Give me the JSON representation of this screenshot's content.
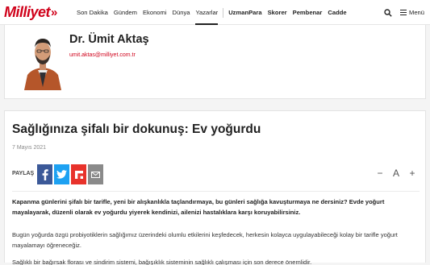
{
  "header": {
    "logo": "Milliyet",
    "nav_left": [
      "Son Dakika",
      "Gündem",
      "Ekonomi",
      "Dünya",
      "Yazarlar"
    ],
    "nav_right": [
      "UzmanPara",
      "Skorer",
      "Pembenar",
      "Cadde"
    ],
    "menu_label": "Menü",
    "accent_color": "#d0021b"
  },
  "author": {
    "name": "Dr. Ümit Aktaş",
    "email": "umit.aktas@milliyet.com.tr"
  },
  "article": {
    "title": "Sağlığınıza şifalı bir dokunuş: Ev yoğurdu",
    "date": "7 Mayıs 2021",
    "share_label": "PAYLAŞ",
    "font_decrease": "−",
    "font_letter": "A",
    "font_increase": "+",
    "lead": "Kapanma günlerini şifalı bir tarifle, yeni bir alışkanlıkla taçlandırmaya, bu günleri sağlığa kavuşturmaya ne dersiniz? Evde yoğurt mayalayarak, düzenli olarak ev yoğurdu yiyerek kendinizi, ailenizi hastalıklara karşı koruyabilirsiniz.",
    "paragraph": "Bugün yoğurda özgü probiyotiklerin sağlığımız üzerindeki olumlu etkilerini keşfedecek, herkesin kolayca uygulayabileceği kolay bir tarifle yoğurt mayalamayı öğreneceğiz.",
    "cut_line": "Sağlıklı bir bağırsak florası ve sindirim sistemi, bağışıklık sisteminin sağlıklı çalışması için son derece önemlidir."
  }
}
